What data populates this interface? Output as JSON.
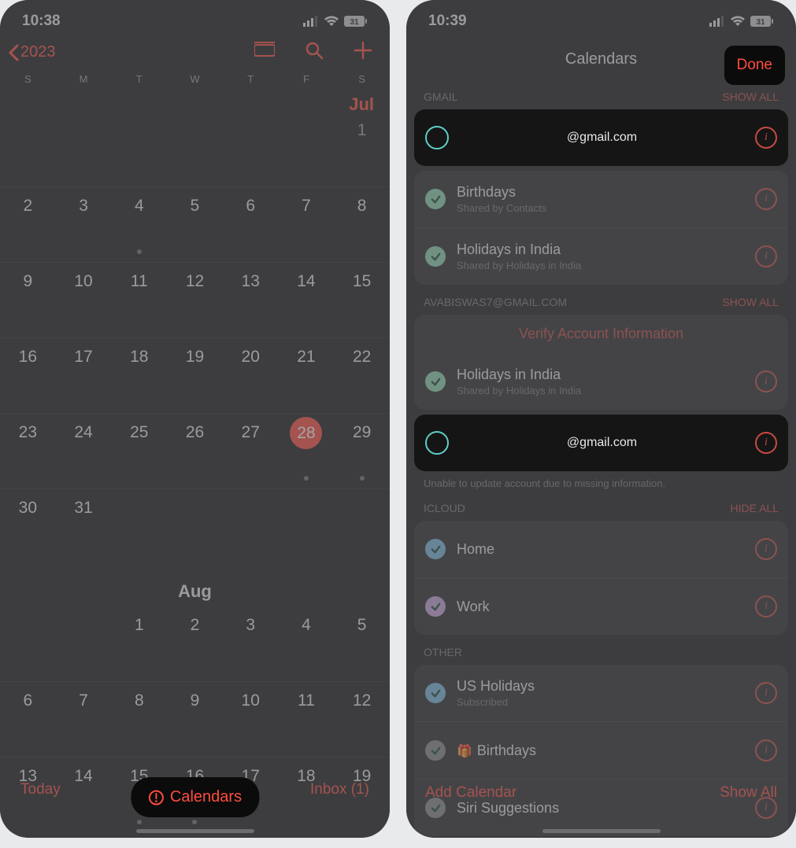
{
  "left": {
    "status_time": "10:38",
    "battery_text": "31",
    "back_year": "2023",
    "weekdays": [
      "S",
      "M",
      "T",
      "W",
      "T",
      "F",
      "S"
    ],
    "jul_label": "Jul",
    "jul_rows": [
      [
        "",
        "",
        "",
        "",
        "",
        "",
        "1"
      ],
      [
        "2",
        "3",
        "4",
        "5",
        "6",
        "7",
        "8"
      ],
      [
        "9",
        "10",
        "11",
        "12",
        "13",
        "14",
        "15"
      ],
      [
        "16",
        "17",
        "18",
        "19",
        "20",
        "21",
        "22"
      ],
      [
        "23",
        "24",
        "25",
        "26",
        "27",
        "28",
        "29"
      ],
      [
        "30",
        "31",
        "",
        "",
        "",
        "",
        ""
      ]
    ],
    "today_value": "28",
    "jul_dots": [
      "4",
      "28",
      "29"
    ],
    "aug_label": "Aug",
    "aug_rows": [
      [
        "",
        "",
        "1",
        "2",
        "3",
        "4",
        "5"
      ],
      [
        "6",
        "7",
        "8",
        "9",
        "10",
        "11",
        "12"
      ],
      [
        "13",
        "14",
        "15",
        "16",
        "17",
        "18",
        "19"
      ]
    ],
    "aug_dots": [
      "15",
      "16"
    ],
    "toolbar": {
      "today": "Today",
      "calendars": "Calendars",
      "inbox": "Inbox (1)"
    }
  },
  "right": {
    "status_time": "10:39",
    "battery_text": "31",
    "sheet_title": "Calendars",
    "done": "Done",
    "sec_gmail": {
      "header": "GMAIL",
      "action": "SHOW ALL",
      "highlight_title": "@gmail.com",
      "rows": [
        {
          "title": "Birthdays",
          "sub": "Shared by Contacts",
          "color": "green"
        },
        {
          "title": "Holidays in India",
          "sub": "Shared by Holidays in India",
          "color": "green"
        }
      ]
    },
    "sec_ava": {
      "header": "AVABISWAS7@GMAIL.COM",
      "action": "SHOW ALL",
      "verify": "Verify Account Information",
      "rows": [
        {
          "title": "Holidays in India",
          "sub": "Shared by Holidays in India",
          "color": "green"
        }
      ],
      "highlight_title": "@gmail.com",
      "note": "Unable to update account due to missing information."
    },
    "sec_icloud": {
      "header": "ICLOUD",
      "action": "HIDE ALL",
      "rows": [
        {
          "title": "Home",
          "color": "blue"
        },
        {
          "title": "Work",
          "color": "purple"
        }
      ]
    },
    "sec_other": {
      "header": "OTHER",
      "rows": [
        {
          "title": "US Holidays",
          "sub": "Subscribed",
          "color": "blue"
        },
        {
          "title": "Birthdays",
          "color": "grey",
          "gift": true
        },
        {
          "title": "Siri Suggestions",
          "color": "grey"
        }
      ]
    },
    "bottom": {
      "add": "Add Calendar",
      "showall": "Show All"
    }
  }
}
